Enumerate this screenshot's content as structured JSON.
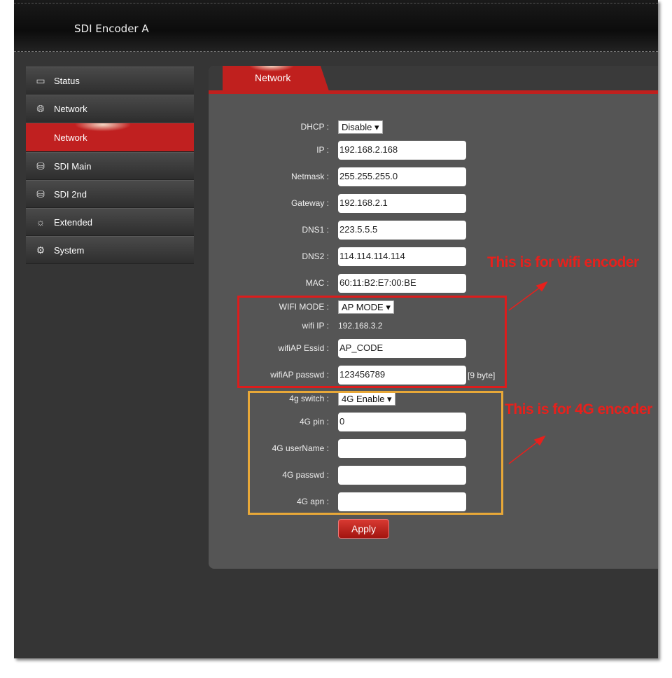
{
  "header": {
    "title": "SDI Encoder  A"
  },
  "sidebar": {
    "items": [
      {
        "label": "Status",
        "icon": "monitor-icon"
      },
      {
        "label": "Network",
        "icon": "globe-icon"
      },
      {
        "label": "Network",
        "icon": "",
        "active": true
      },
      {
        "label": "SDI Main",
        "icon": "disk-icon"
      },
      {
        "label": "SDI 2nd",
        "icon": "disk-icon"
      },
      {
        "label": "Extended",
        "icon": "sun-gear-icon"
      },
      {
        "label": "System",
        "icon": "gear-icon"
      }
    ]
  },
  "panel": {
    "tab": "Network"
  },
  "form": {
    "dhcp": {
      "label": "DHCP :",
      "value": "Disable ▾"
    },
    "ip": {
      "label": "IP :",
      "value": "192.168.2.168"
    },
    "netmask": {
      "label": "Netmask :",
      "value": "255.255.255.0"
    },
    "gateway": {
      "label": "Gateway :",
      "value": "192.168.2.1"
    },
    "dns1": {
      "label": "DNS1 :",
      "value": "223.5.5.5"
    },
    "dns2": {
      "label": "DNS2 :",
      "value": "114.114.114.114"
    },
    "mac": {
      "label": "MAC :",
      "value": "60:11:B2:E7:00:BE"
    },
    "wifi_mode": {
      "label": "WIFI MODE :",
      "value": "AP MODE  ▾"
    },
    "wifi_ip": {
      "label": "wifi IP :",
      "value": "192.168.3.2"
    },
    "essid": {
      "label": "wifiAP Essid :",
      "value": "AP_CODE"
    },
    "passwd": {
      "label": "wifiAP passwd :",
      "value": "123456789",
      "hint": "[9 byte]"
    },
    "g4_switch": {
      "label": "4g switch :",
      "value": "4G Enable ▾"
    },
    "g4_pin": {
      "label": "4G pin :",
      "value": "0"
    },
    "g4_user": {
      "label": "4G userName :",
      "value": ""
    },
    "g4_passwd": {
      "label": "4G passwd :",
      "value": ""
    },
    "g4_apn": {
      "label": "4G apn :",
      "value": ""
    },
    "apply": "Apply"
  },
  "annotations": {
    "wifi": "This is for wifi encoder",
    "g4": "This is for 4G encoder",
    "colors": {
      "wifi_box": "#dd1c1c",
      "g4_box": "#e8a838"
    }
  }
}
